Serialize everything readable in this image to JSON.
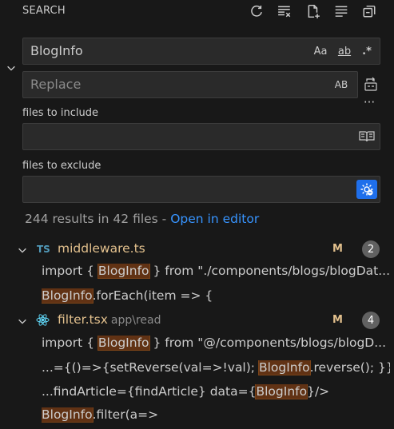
{
  "header": {
    "title": "SEARCH",
    "actions": [
      {
        "name": "refresh",
        "icon": "refresh-icon"
      },
      {
        "name": "clear-results",
        "icon": "clear-all-icon"
      },
      {
        "name": "new-search-editor",
        "icon": "new-file-icon"
      },
      {
        "name": "view-as-tree",
        "icon": "list-tree-icon"
      },
      {
        "name": "collapse-all",
        "icon": "collapse-all-icon"
      }
    ]
  },
  "search": {
    "value": "BlogInfo",
    "options": {
      "match_case": "Aa",
      "whole_word": "ab",
      "regex": ".*"
    }
  },
  "replace": {
    "placeholder": "Replace",
    "preserve_case": "AB"
  },
  "files_include": {
    "label": "files to include",
    "value": ""
  },
  "files_exclude": {
    "label": "files to exclude",
    "value": ""
  },
  "summary": {
    "text": "244 results in 42 files - ",
    "link": "Open in editor"
  },
  "results": [
    {
      "file_icon": "TS",
      "file_icon_color": "#519aba",
      "filename": "middleware.ts",
      "dir": "",
      "git_status": "M",
      "count": "2",
      "matches": [
        {
          "before": "import { ",
          "match": "BlogInfo",
          "after": " } from \"./components/blogs/blogDat..."
        },
        {
          "before": "",
          "match": "BlogInfo",
          "after": ".forEach(item => {"
        }
      ]
    },
    {
      "file_icon": "react-icon",
      "file_icon_color": "#61dafb",
      "filename": "filter.tsx",
      "dir": "app\\read",
      "git_status": "M",
      "count": "4",
      "matches": [
        {
          "before": "import { ",
          "match": "BlogInfo",
          "after": " } from \"@/components/blogs/blogD..."
        },
        {
          "before": "...={()=>{setReverse(val=>!val); ",
          "match": "BlogInfo",
          "after": ".reverse(); }}/>"
        },
        {
          "before": "...findArticle={findArticle} data={",
          "match": "BlogInfo",
          "after": "}/>"
        },
        {
          "before": "",
          "match": "BlogInfo",
          "after": ".filter(a=>"
        }
      ]
    }
  ],
  "colors": {
    "background": "#181818",
    "input_background": "#2a2a2a",
    "highlight": "#613214",
    "link": "#3794ff",
    "modified": "#e2c08d",
    "active_button": "#1f6feb"
  }
}
